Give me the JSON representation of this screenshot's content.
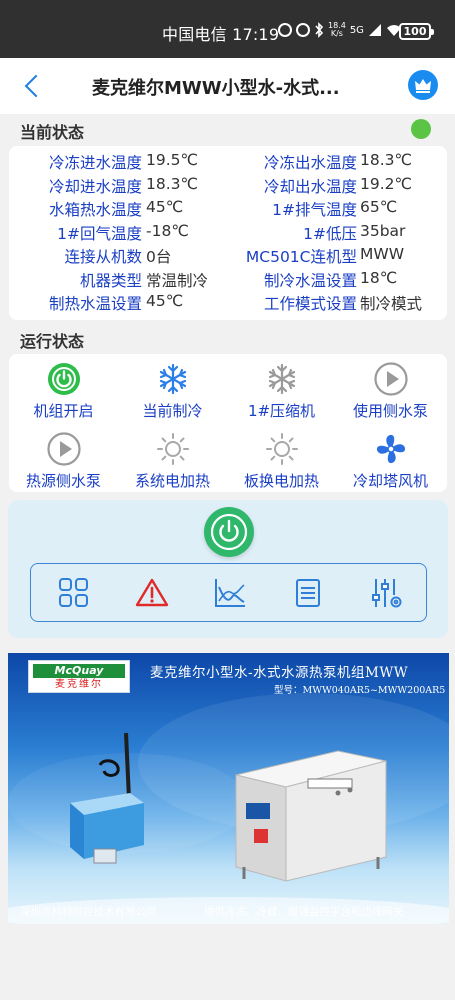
{
  "status_bar": {
    "carrier_time": "中国电信 17:19",
    "net_speed_value": "18.4",
    "net_speed_unit": "K/s",
    "signal": "5G",
    "battery": "100"
  },
  "app_bar": {
    "title": "麦克维尔MWW小型水-水式..."
  },
  "current_state": {
    "title": "当前状态",
    "indicator_color": "#5cc444",
    "rows": [
      {
        "label1": "冷冻进水温度",
        "value1": "19.5℃",
        "label2": "冷冻出水温度",
        "value2": "18.3℃"
      },
      {
        "label1": "冷却进水温度",
        "value1": "18.3℃",
        "label2": "冷却出水温度",
        "value2": "19.2℃"
      },
      {
        "label1": "水箱热水温度",
        "value1": "45℃",
        "label2": "1#排气温度",
        "value2": "65℃"
      },
      {
        "label1": "1#回气温度",
        "value1": "-18℃",
        "label2": "1#低压",
        "value2": "35bar"
      },
      {
        "label1": "连接从机数",
        "value1": "0台",
        "label2": "MC501C连机型",
        "value2": "MWW"
      },
      {
        "label1": "机器类型",
        "value1": "常温制冷",
        "label2": "制冷水温设置",
        "value2": "18℃"
      },
      {
        "label1": "制热水温设置",
        "value1": "45℃",
        "label2": "工作模式设置",
        "value2": "制冷模式"
      }
    ]
  },
  "run_state": {
    "title": "运行状态",
    "items": [
      {
        "label": "机组开启",
        "icon": "power-on-icon"
      },
      {
        "label": "当前制冷",
        "icon": "snowflake-icon"
      },
      {
        "label": "1#压缩机",
        "icon": "snowflake-icon"
      },
      {
        "label": "使用侧水泵",
        "icon": "play-icon"
      },
      {
        "label": "热源侧水泵",
        "icon": "play-icon"
      },
      {
        "label": "系统电加热",
        "icon": "sun-icon"
      },
      {
        "label": "板换电加热",
        "icon": "sun-icon"
      },
      {
        "label": "冷却塔风机",
        "icon": "fan-icon"
      }
    ]
  },
  "controls": {
    "power_icon": "power-icon",
    "tools": [
      "grid-icon",
      "alarm-icon",
      "curve-icon",
      "list-icon",
      "settings-sliders-icon"
    ]
  },
  "banner": {
    "logo_brand": "McQuay",
    "logo_cn": "麦克维尔",
    "title": "麦克维尔小型水-水式水源热泵机组MWW",
    "model": "型号：MWW040AR5~MWW200AR5",
    "company": "深圳市科特时控技术有限公司",
    "slogan": "提供冷冻、冷藏、暖通监控平台和边缘网关"
  },
  "colors": {
    "label_blue": "#1a3fc4",
    "accent_blue": "#1e7fe0",
    "power_green": "#2fb86b"
  }
}
